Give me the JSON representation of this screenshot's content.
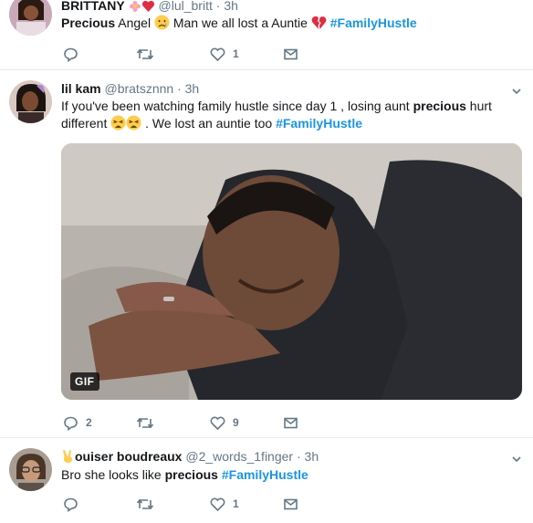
{
  "tweets": [
    {
      "name": "BRITTANY",
      "name_emojis": [
        "flower-emoji",
        "heart-emoji"
      ],
      "handle": "@lul_britt",
      "dot": "·",
      "time": "3h",
      "text": {
        "bold": "Precious",
        "middle": " Angel ",
        "after_emoji": " Man we all lost a Auntie ",
        "hashtag": "#FamilyHustle"
      },
      "reply_count": "",
      "retweet_count": "",
      "like_count": "1"
    },
    {
      "name": "lil kam",
      "handle": "@bratsznnn",
      "dot": "·",
      "time": "3h",
      "text": {
        "line1_start": "If you've been watching family hustle since day 1 , losing aunt ",
        "bold": "precious",
        "line1_end": " hurt",
        "line2_start": "different ",
        "line2_end": " . We lost an auntie too ",
        "hashtag": "#FamilyHustle"
      },
      "media_badge": "GIF",
      "reply_count": "2",
      "retweet_count": "",
      "like_count": "9"
    },
    {
      "name": "ouiser boudreaux",
      "name_emoji": "victory-hand-emoji",
      "handle": "@2_words_1finger",
      "dot": "·",
      "time": "3h",
      "text": {
        "start": "Bro she looks like ",
        "bold": "precious",
        "space": " ",
        "hashtag": "#FamilyHustle"
      },
      "reply_count": "",
      "retweet_count": "",
      "like_count": "1"
    }
  ],
  "colors": {
    "link": "#1b95e0",
    "muted": "#657786",
    "text": "#14171a",
    "divider": "#e6ecf0"
  }
}
